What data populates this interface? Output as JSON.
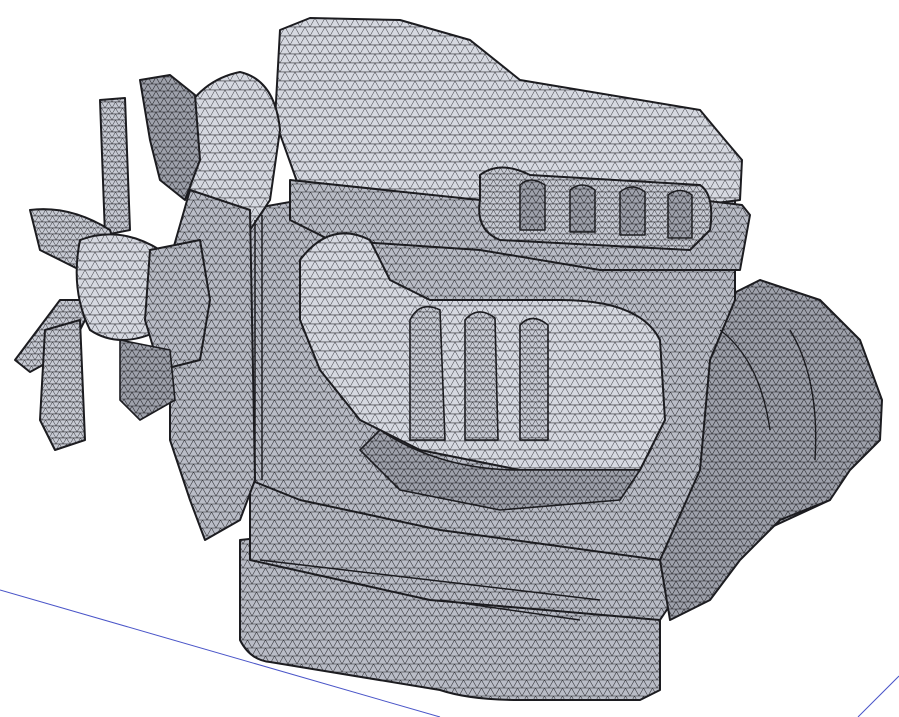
{
  "viewport": {
    "background": "#ffffff",
    "ground_line_color": "#4a55c8",
    "mesh_fill": "#b9bcc6",
    "mesh_fill_light": "#d4d7df",
    "mesh_fill_dark": "#8f929c",
    "mesh_edge_color": "#2a2a2e",
    "outline_color": "#1c1c20",
    "model": "engine-block-mesh"
  }
}
